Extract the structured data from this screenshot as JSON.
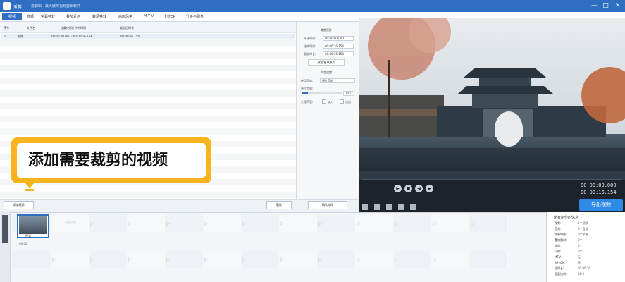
{
  "app": {
    "name": "爱剪",
    "subtitle": "爱剪辑 - 最火爆的视频剪辑软件",
    "window_controls": [
      "—",
      "□",
      "✕"
    ]
  },
  "menu": {
    "items": [
      "视频",
      "音频",
      "字幕特效",
      "叠加素材",
      "转场特效",
      "画面风格",
      "M T V",
      "卡拉OK",
      "升级与服务"
    ]
  },
  "list": {
    "columns": [
      "序号",
      "文件名",
      "在最终影片中的时间",
      "裁剪后时长"
    ],
    "rows": [
      {
        "index": "01",
        "name": "视频",
        "time": "00:00:00.000 - 00:00:16.154",
        "duration": "00:00:16.154"
      }
    ]
  },
  "settings": {
    "section_clip": "裁剪原片",
    "start_label": "开始时间:",
    "start_value": "00:00:00.000",
    "end_label": "结束时间:",
    "end_value": "00:00:16.154",
    "duration_label": "截取时长:",
    "duration_value": "00:00:16.154",
    "preview_clip_btn": "预览/截取原片",
    "section_audio": "声音设置",
    "track_label": "使用音轨:",
    "track_value": "原片音轨",
    "volume_label": "原片音量:",
    "volume_value": "100",
    "fade_label": "头尾声音:",
    "fade_in": "淡入",
    "fade_out": "淡出"
  },
  "playback": {
    "current_time": "00:00:00.000",
    "total_time": "00:00:16.154",
    "progress": 0,
    "export_btn": "导出视频"
  },
  "bottom_bar": {
    "add_video": "添加视频",
    "delete": "删除",
    "confirm": "确认修改"
  },
  "callout": {
    "text": "添加需要裁剪的视频"
  },
  "timeline": {
    "side_label": "已添加片段",
    "clip_name": "视频",
    "clip_note": "00:00",
    "empty_slot_label": "双击添加"
  },
  "info": {
    "title": "所有制作的信息",
    "rows": [
      {
        "k": "视频:",
        "v": "1个视频"
      },
      {
        "k": "音频:",
        "v": "0个音频"
      },
      {
        "k": "字幕特效:",
        "v": "0个字幕"
      },
      {
        "k": "叠加素材:",
        "v": "0个"
      },
      {
        "k": "转场:",
        "v": "0个"
      },
      {
        "k": "风格:",
        "v": "0个"
      },
      {
        "k": "MTV:",
        "v": "无"
      },
      {
        "k": "卡拉OK:",
        "v": "无"
      },
      {
        "k": "总时长:",
        "v": "00:00:16"
      },
      {
        "k": "画面比例:",
        "v": "16:9"
      }
    ]
  },
  "colors": {
    "accent": "#2f6fc2",
    "callout": "#f7b41c",
    "export": "#2f8ae6"
  }
}
